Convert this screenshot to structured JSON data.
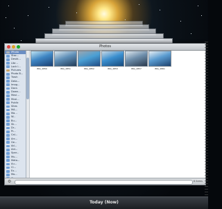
{
  "window": {
    "title": "Photos",
    "traffic_lights": [
      "#e0443e",
      "#dea123",
      "#1aab29"
    ]
  },
  "sidebar": {
    "items": [
      {
        "label": "iPhoto",
        "icon": "drive-icon",
        "selected": true
      },
      {
        "label": "Stac...",
        "icon": "folder-icon"
      },
      {
        "label": "Deskt...",
        "icon": "folder-icon"
      },
      {
        "label": "Libr...",
        "icon": "folder-icon"
      },
      {
        "label": "Lock I...",
        "icon": "folder-icon"
      },
      {
        "label": "Pictures",
        "icon": "home-icon"
      },
      {
        "label": "Photo B...",
        "icon": "folder-icon"
      },
      {
        "label": "Trash",
        "icon": "folder-icon"
      },
      {
        "label": "Deta...",
        "icon": "folder-icon"
      },
      {
        "label": "Imag...",
        "icon": "folder-icon"
      },
      {
        "label": "Docs",
        "icon": "folder-icon"
      },
      {
        "label": "Down...",
        "icon": "folder-icon"
      },
      {
        "label": "Movi...",
        "icon": "folder-icon"
      },
      {
        "label": "Musi...",
        "icon": "folder-icon"
      },
      {
        "label": "Public",
        "icon": "folder-icon"
      },
      {
        "label": "Sites",
        "icon": "folder-icon"
      },
      {
        "label": "MA...",
        "icon": "folder-icon"
      },
      {
        "label": "Ma...",
        "icon": "folder-icon"
      },
      {
        "label": "W...",
        "icon": "folder-icon"
      },
      {
        "label": "Bu...",
        "icon": "folder-icon"
      },
      {
        "label": "Sk...",
        "icon": "folder-icon"
      },
      {
        "label": "Dr...",
        "icon": "folder-icon"
      },
      {
        "label": "Pr...",
        "icon": "folder-icon"
      },
      {
        "label": "Cal...",
        "icon": "folder-icon"
      },
      {
        "label": "Arc...",
        "icon": "folder-icon"
      },
      {
        "label": "Ge...",
        "icon": "folder-icon"
      },
      {
        "label": "Ad...",
        "icon": "folder-icon"
      },
      {
        "label": "Aid...",
        "icon": "folder-icon"
      },
      {
        "label": "Spar...",
        "icon": "folder-icon"
      },
      {
        "label": "Mu...",
        "icon": "folder-icon"
      },
      {
        "label": "Meta...",
        "icon": "folder-icon"
      },
      {
        "label": "Au...",
        "icon": "folder-icon"
      },
      {
        "label": "Cl...",
        "icon": "folder-icon"
      },
      {
        "label": "Ex...",
        "icon": "folder-icon"
      },
      {
        "label": "Mo...",
        "icon": "folder-icon"
      },
      {
        "label": "Sb...",
        "icon": "folder-icon"
      }
    ]
  },
  "photos": [
    {
      "label": "IMG_2850",
      "colors": [
        "#1a3f72",
        "#3f86c4",
        "#bfe3f2"
      ]
    },
    {
      "label": "IMG_2851",
      "colors": [
        "#223b57",
        "#5f8fb8",
        "#d9e6ee"
      ]
    },
    {
      "label": "IMG_2852",
      "colors": [
        "#1f4c86",
        "#4a9fd4",
        "#9aa6b0"
      ]
    },
    {
      "label": "IMG_2853",
      "colors": [
        "#164a7d",
        "#3b8fcf",
        "#c7d8e6"
      ]
    },
    {
      "label": "IMG_2857",
      "colors": [
        "#2a3a4e",
        "#6e8eab",
        "#dfe8ee"
      ]
    },
    {
      "label": "IMG_2861",
      "colors": [
        "#1d426f",
        "#5a9bd0",
        "#e7eef3"
      ]
    }
  ],
  "statusbar": {
    "info_text": "6 items",
    "info_icon": "gear-icon"
  },
  "timeline": {
    "label": "Today (Now)"
  }
}
